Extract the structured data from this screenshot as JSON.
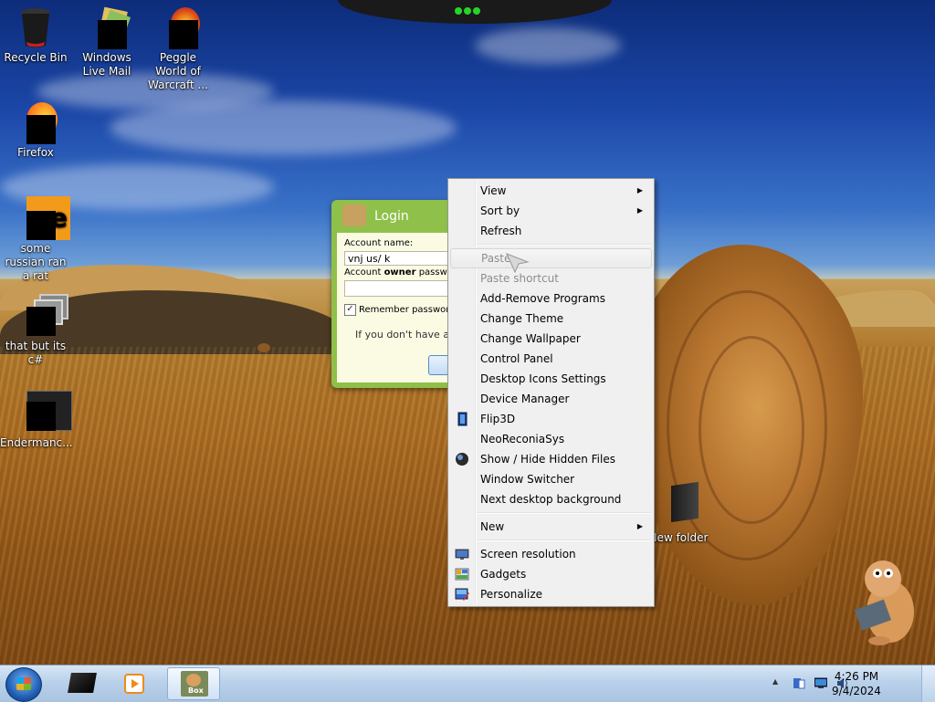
{
  "desktop_icons": [
    {
      "label": "Recycle Bin"
    },
    {
      "label": "Windows Live Mail"
    },
    {
      "label": "Peggle World of Warcraft ..."
    },
    {
      "label": "Firefox"
    },
    {
      "label": "some russian ran a rat"
    },
    {
      "label": "that but its c#"
    },
    {
      "label": "Endermanc..."
    },
    {
      "label": "New folder"
    }
  ],
  "login": {
    "title": "Login",
    "account_label": "Account name:",
    "account_value": "vnj us/ k",
    "owner_label_prefix": "Account ",
    "owner_label_bold": "owner",
    "owner_label_suffix": " password",
    "remember_label": "Remember password",
    "remember_checked": "✓",
    "signup_text": "If you don't have an"
  },
  "context_menu": {
    "items": [
      {
        "label": "View",
        "arrow": "▶"
      },
      {
        "label": "Sort by",
        "arrow": "▶"
      },
      {
        "label": "Refresh"
      },
      {
        "label": "Paste"
      },
      {
        "label": "Paste shortcut"
      },
      {
        "label": "Add-Remove Programs"
      },
      {
        "label": "Change Theme"
      },
      {
        "label": "Change Wallpaper"
      },
      {
        "label": "Control Panel"
      },
      {
        "label": "Desktop Icons Settings"
      },
      {
        "label": "Device Manager"
      },
      {
        "label": "Flip3D"
      },
      {
        "label": "NeoReconiaSys"
      },
      {
        "label": "Show / Hide Hidden Files"
      },
      {
        "label": "Window Switcher"
      },
      {
        "label": "Next desktop background"
      },
      {
        "label": "New",
        "arrow": "▶"
      },
      {
        "label": "Screen resolution"
      },
      {
        "label": "Gadgets"
      },
      {
        "label": "Personalize"
      }
    ]
  },
  "taskbar": {
    "active_app_label": "Box",
    "clock_time": "4:26 PM",
    "clock_date": "9/4/2024",
    "tray_chevron": "▲"
  },
  "colors": {
    "menu_bg": "#f0f0f0",
    "login_green": "#8fc04a",
    "taskbar": "#b9d1ea"
  }
}
